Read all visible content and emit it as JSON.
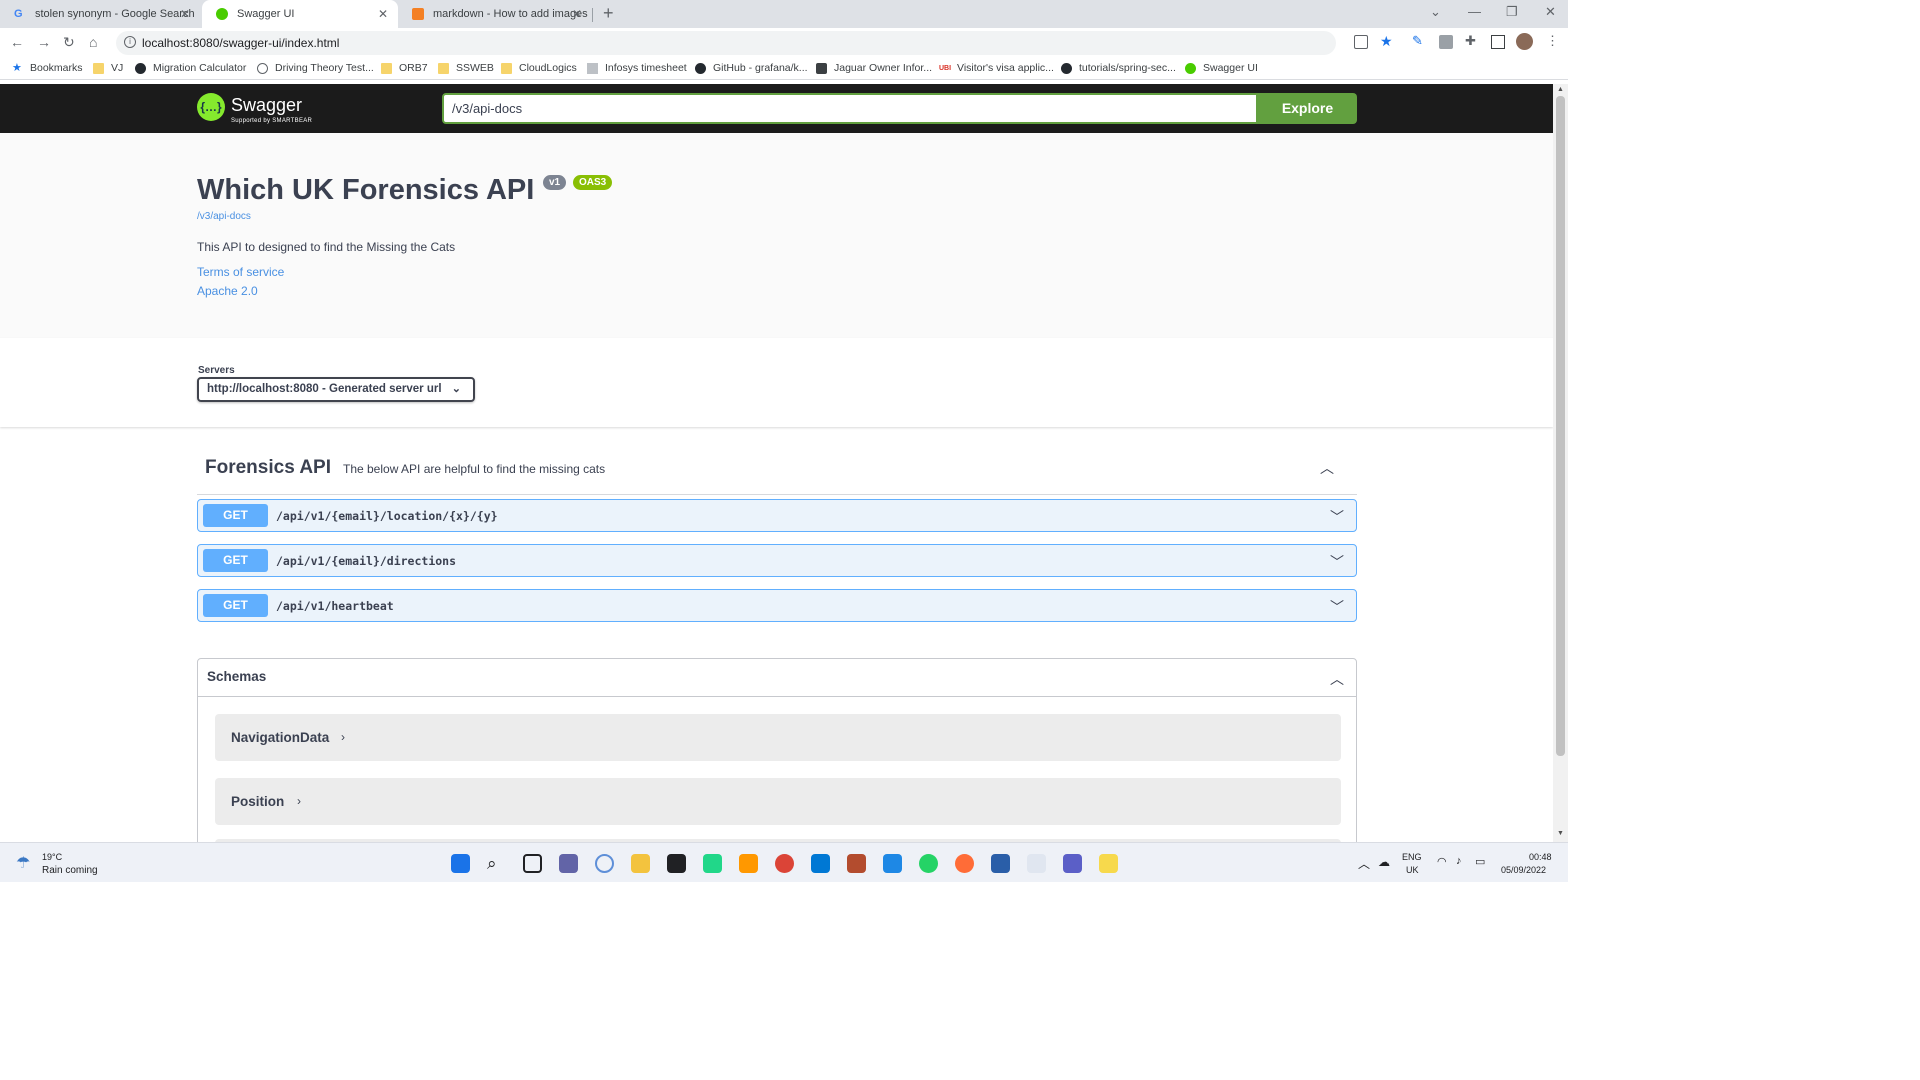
{
  "browser": {
    "tabs": [
      {
        "title": "stolen synonym - Google Search",
        "active": false
      },
      {
        "title": "Swagger UI",
        "active": true
      },
      {
        "title": "markdown - How to add images",
        "active": false
      }
    ],
    "address": "localhost:8080/swagger-ui/index.html",
    "bookmarks": [
      "Bookmarks",
      "VJ",
      "Migration Calculator",
      "Driving Theory Test...",
      "ORB7",
      "SSWEB",
      "CloudLogics",
      "Infosys timesheet",
      "GitHub - grafana/k...",
      "Jaguar Owner Infor...",
      "Visitor's visa applic...",
      "tutorials/spring-sec...",
      "Swagger UI"
    ]
  },
  "swagger": {
    "brand": "Swagger",
    "brand_sub": "Supported by SMARTBEAR",
    "url_value": "/v3/api-docs",
    "explore_label": "Explore"
  },
  "info": {
    "title": "Which UK Forensics API",
    "version": "v1",
    "oas": "OAS3",
    "docs_link": "/v3/api-docs",
    "description": "This API to designed to find the Missing the Cats",
    "terms": "Terms of service",
    "license": "Apache 2.0"
  },
  "servers": {
    "label": "Servers",
    "selected": "http://localhost:8080 - Generated server url"
  },
  "tag": {
    "name": "Forensics API",
    "description": "The below API are helpful to find the missing cats",
    "operations": [
      {
        "method": "GET",
        "path": "/api/v1/{email}/location/{x}/{y}"
      },
      {
        "method": "GET",
        "path": "/api/v1/{email}/directions"
      },
      {
        "method": "GET",
        "path": "/api/v1/heartbeat"
      }
    ]
  },
  "schemas": {
    "title": "Schemas",
    "models": [
      "NavigationData",
      "Position"
    ]
  },
  "taskbar": {
    "temp": "19°C",
    "weather": "Rain coming",
    "lang": "ENG",
    "region": "UK",
    "time": "00:48",
    "date": "05/09/2022"
  },
  "colors": {
    "get_method": "#61affe",
    "explore_green": "#62a03f",
    "oas_badge": "#89bf04",
    "link": "#4990e2"
  }
}
